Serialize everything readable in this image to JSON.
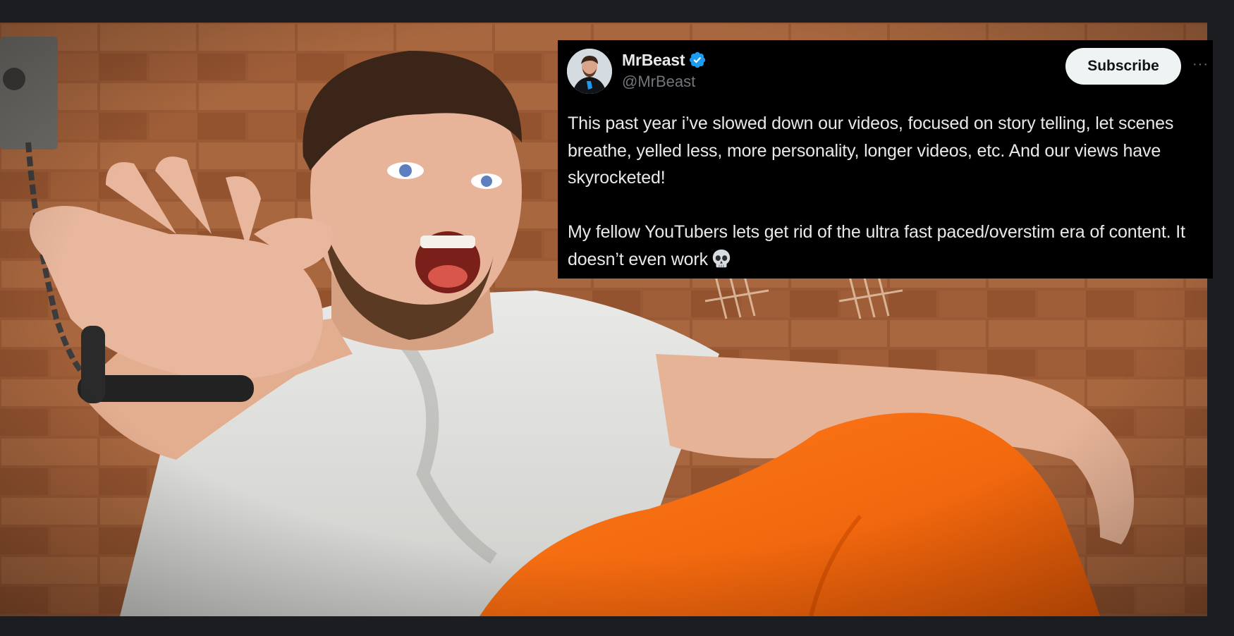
{
  "post": {
    "display_name": "MrBeast",
    "handle": "@MrBeast",
    "verified_icon": "verified-badge-icon",
    "subscribe_label": "Subscribe",
    "more_icon": "more-horizontal-icon",
    "more_glyph": "···",
    "paragraphs": [
      "This past year i’ve slowed down our videos, focused on story telling, let scenes breathe, yelled less, more personality, longer videos, etc. And our views have skyrocketed!",
      "My fellow YouTubers lets get rid of the ultra fast paced/overstim era of content. It doesn’t even work"
    ],
    "trailing_emoji": "skull-emoji-icon"
  },
  "colors": {
    "card_background": "#000000",
    "text_primary": "#e7e9ea",
    "text_secondary": "#71767b",
    "verified_blue": "#1d9bf0",
    "subscribe_bg": "#eff3f4",
    "page_background": "#1c1d20"
  }
}
